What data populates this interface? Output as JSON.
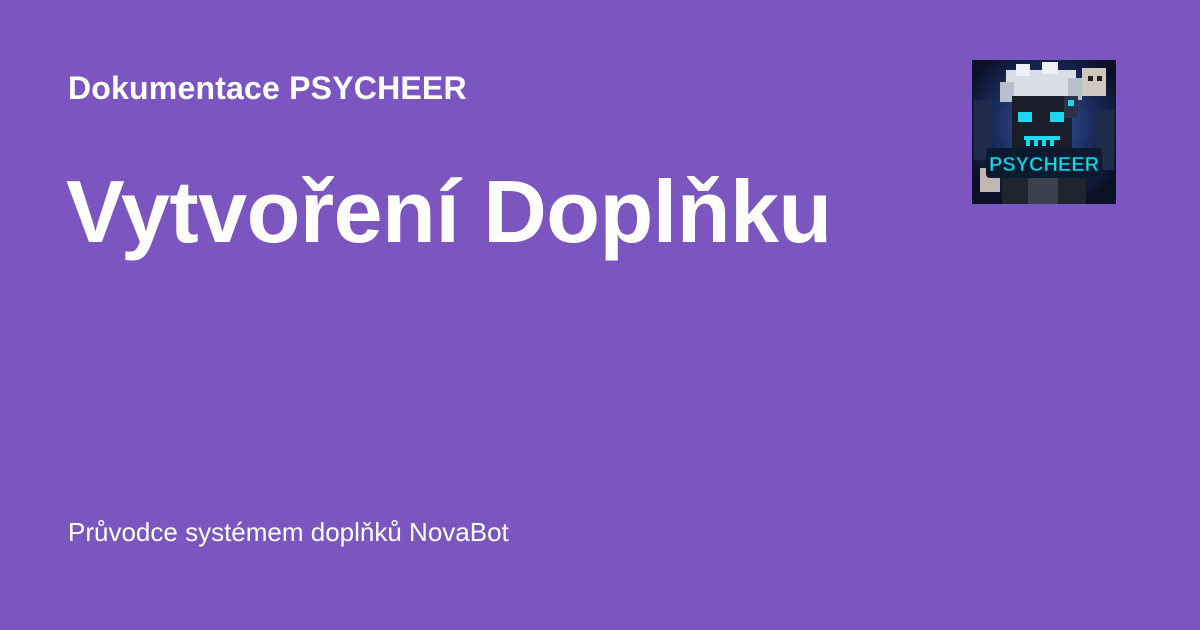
{
  "site": {
    "name": "Dokumentace PSYCHEER"
  },
  "page": {
    "title": "Vytvoření Doplňku",
    "description": "Průvodce systémem doplňků NovaBot"
  },
  "logo": {
    "text": "PSYCHEER",
    "icon": "psycheer-avatar-logo"
  },
  "colors": {
    "background": "#7c56c0",
    "text": "#ffffff",
    "logo_accent": "#19d8f0"
  }
}
